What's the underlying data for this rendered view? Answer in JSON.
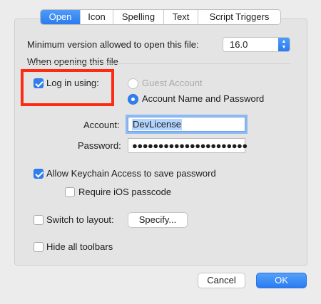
{
  "tabs": [
    {
      "label": "Open",
      "active": true
    },
    {
      "label": "Icon",
      "active": false
    },
    {
      "label": "Spelling",
      "active": false
    },
    {
      "label": "Text",
      "active": false
    },
    {
      "label": "Script Triggers",
      "active": false
    }
  ],
  "min_version": {
    "label": "Minimum version allowed to open this file:",
    "value": "16.0"
  },
  "section_heading": "When opening this file",
  "login": {
    "checkbox_label": "Log in using:",
    "checked": true,
    "options": [
      {
        "label": "Guest Account",
        "selected": false,
        "enabled": false
      },
      {
        "label": "Account Name and Password",
        "selected": true,
        "enabled": true
      }
    ]
  },
  "credentials": {
    "account_label": "Account:",
    "account_value": "DevLicense",
    "password_label": "Password:",
    "password_mask": "●●●●●●●●●●●●●●●●●●●●●●"
  },
  "keychain": {
    "label": "Allow Keychain Access to save password",
    "checked": true
  },
  "ios_passcode": {
    "label": "Require iOS passcode",
    "checked": false
  },
  "switch_layout": {
    "label": "Switch to layout:",
    "checked": false,
    "button_label": "Specify..."
  },
  "hide_toolbars": {
    "label": "Hide all toolbars",
    "checked": false
  },
  "footer": {
    "cancel_label": "Cancel",
    "ok_label": "OK"
  },
  "colors": {
    "accent": "#2f7ff2",
    "highlight_box": "#ff2a12"
  }
}
